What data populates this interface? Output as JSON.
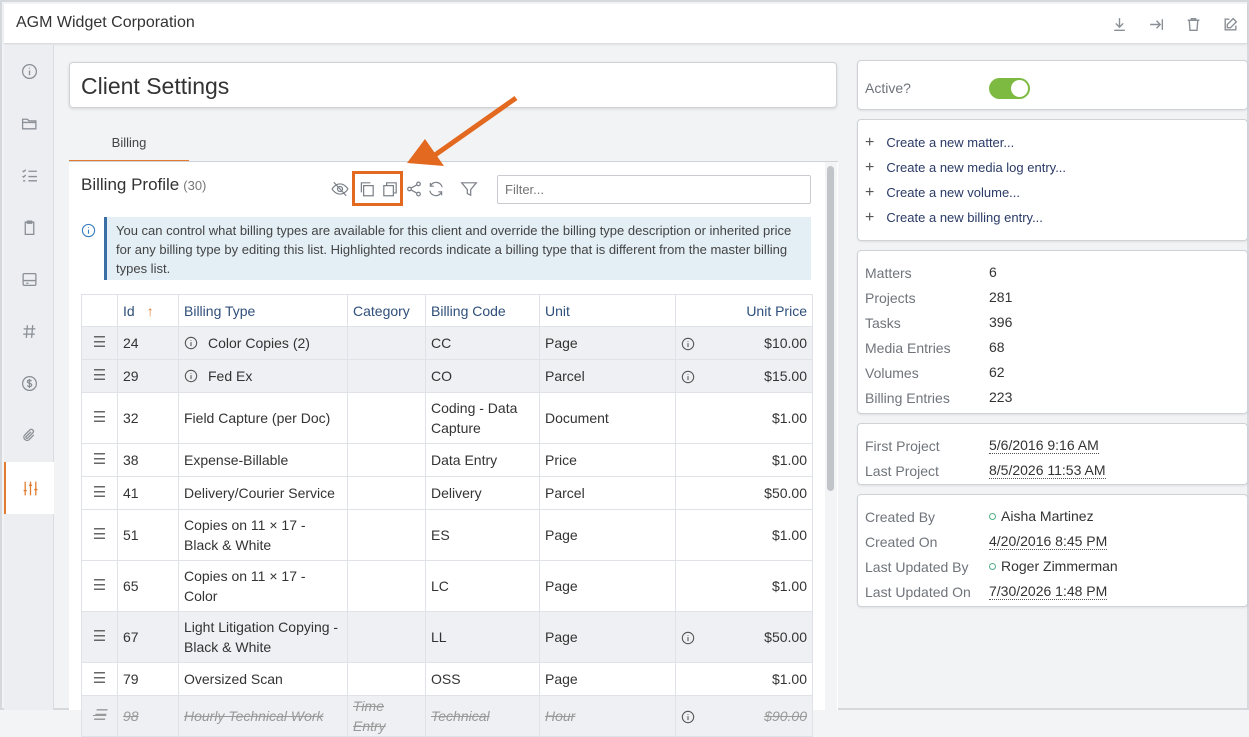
{
  "header": {
    "title": "AGM Widget Corporation",
    "icons": [
      "download-icon",
      "export-icon",
      "trash-icon",
      "edit-icon"
    ]
  },
  "sidebar": {
    "items": [
      {
        "icon": "info-icon"
      },
      {
        "icon": "folder-icon"
      },
      {
        "icon": "checklist-icon"
      },
      {
        "icon": "clipboard-icon"
      },
      {
        "icon": "inbox-icon"
      },
      {
        "icon": "hash-icon"
      },
      {
        "icon": "dollar-icon"
      },
      {
        "icon": "paperclip-icon"
      },
      {
        "icon": "sliders-icon",
        "active": true
      }
    ]
  },
  "page": {
    "title": "Client Settings",
    "tab": "Billing"
  },
  "billing_profile": {
    "title": "Billing Profile",
    "count": "(30)",
    "filter_placeholder": "Filter...",
    "info": "You can control what billing types are available for this client and override the billing type description or inherited price for any billing type by editing this list. Highlighted records indicate a billing type that is different from the master billing types list.",
    "columns": {
      "id": "Id",
      "billing_type": "Billing Type",
      "category": "Category",
      "billing_code": "Billing Code",
      "unit": "Unit",
      "unit_price": "Unit Price"
    },
    "rows": [
      {
        "id": "24",
        "type": "Color Copies (2)",
        "category": "",
        "code": "CC",
        "unit": "Page",
        "price": "$10.00",
        "type_info": true,
        "price_info": true,
        "shaded": true,
        "struck": false
      },
      {
        "id": "29",
        "type": "Fed Ex",
        "category": "",
        "code": "CO",
        "unit": "Parcel",
        "price": "$15.00",
        "type_info": true,
        "price_info": true,
        "shaded": true,
        "struck": false
      },
      {
        "id": "32",
        "type": "Field Capture (per Doc)",
        "category": "",
        "code": "Coding - Data Capture",
        "unit": "Document",
        "price": "$1.00",
        "type_info": false,
        "price_info": false,
        "shaded": false,
        "struck": false
      },
      {
        "id": "38",
        "type": "Expense-Billable",
        "category": "",
        "code": "Data Entry",
        "unit": "Price",
        "price": "$1.00",
        "type_info": false,
        "price_info": false,
        "shaded": false,
        "struck": false
      },
      {
        "id": "41",
        "type": "Delivery/Courier Service",
        "category": "",
        "code": "Delivery",
        "unit": "Parcel",
        "price": "$50.00",
        "type_info": false,
        "price_info": false,
        "shaded": false,
        "struck": false
      },
      {
        "id": "51",
        "type": "Copies on 11 × 17 - Black & White",
        "category": "",
        "code": "ES",
        "unit": "Page",
        "price": "$1.00",
        "type_info": false,
        "price_info": false,
        "shaded": false,
        "struck": false
      },
      {
        "id": "65",
        "type": "Copies on 11 × 17 - Color",
        "category": "",
        "code": "LC",
        "unit": "Page",
        "price": "$1.00",
        "type_info": false,
        "price_info": false,
        "shaded": false,
        "struck": false
      },
      {
        "id": "67",
        "type": "Light Litigation Copying - Black & White",
        "category": "",
        "code": "LL",
        "unit": "Page",
        "price": "$50.00",
        "type_info": false,
        "price_info": true,
        "shaded": true,
        "struck": false
      },
      {
        "id": "79",
        "type": "Oversized Scan",
        "category": "",
        "code": "OSS",
        "unit": "Page",
        "price": "$1.00",
        "type_info": false,
        "price_info": false,
        "shaded": false,
        "struck": false
      },
      {
        "id": "98",
        "type": "Hourly Technical Work",
        "category": "Time Entry",
        "code": "Technical",
        "unit": "Hour",
        "price": "$90.00",
        "type_info": false,
        "price_info": true,
        "shaded": true,
        "struck": true
      }
    ]
  },
  "right_panel": {
    "active_label": "Active?",
    "active": true,
    "actions": [
      "Create a new matter...",
      "Create a new media log entry...",
      "Create a new volume...",
      "Create a new billing entry..."
    ],
    "stats": [
      {
        "label": "Matters",
        "value": "6"
      },
      {
        "label": "Projects",
        "value": "281"
      },
      {
        "label": "Tasks",
        "value": "396"
      },
      {
        "label": "Media Entries",
        "value": "68"
      },
      {
        "label": "Volumes",
        "value": "62"
      },
      {
        "label": "Billing Entries",
        "value": "223"
      }
    ],
    "dates": [
      {
        "label": "First Project",
        "value": "5/6/2016 9:16 AM"
      },
      {
        "label": "Last Project",
        "value": "8/5/2026 11:53 AM"
      }
    ],
    "audit": [
      {
        "label": "Created By",
        "value": "Aisha Martinez",
        "user": true
      },
      {
        "label": "Created On",
        "value": "4/20/2016 8:45 PM",
        "user": false
      },
      {
        "label": "Last Updated By",
        "value": "Roger Zimmerman",
        "user": true
      },
      {
        "label": "Last Updated On",
        "value": "7/30/2026 1:48 PM",
        "user": false
      }
    ]
  },
  "colors": {
    "accent": "#e07b2f",
    "callout": "#e2691f",
    "toggle_on": "#7dba42",
    "info_bg": "#e3eef5"
  }
}
